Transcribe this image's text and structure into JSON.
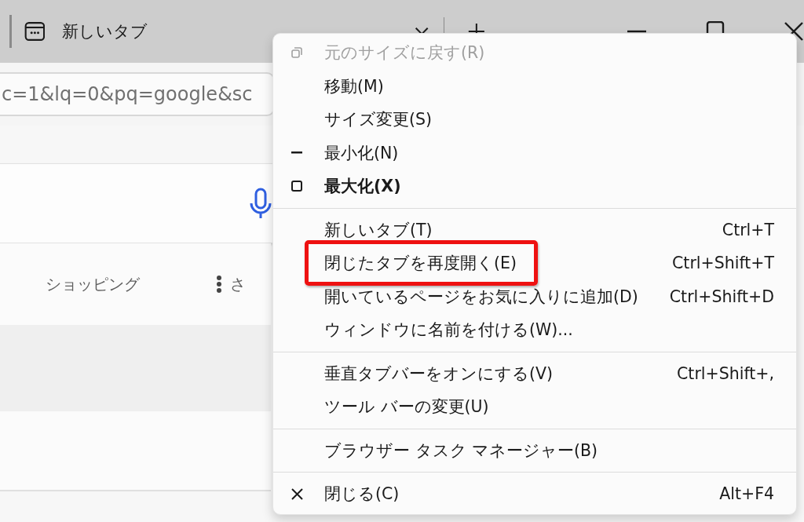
{
  "window": {
    "tab_title": "新しいタブ"
  },
  "address_bar": {
    "value": "c=1&lq=0&pq=google&sc"
  },
  "nav": {
    "items": [
      "ショッピング"
    ],
    "more_label": "さ"
  },
  "system_menu": [
    {
      "kind": "restore",
      "label": "元のサイズに戻す(R)",
      "disabled": true,
      "default": false,
      "highlighted": false
    },
    {
      "kind": "plain",
      "label": "移動(M)",
      "disabled": false,
      "default": false,
      "highlighted": false
    },
    {
      "kind": "plain",
      "label": "サイズ変更(S)",
      "disabled": false,
      "default": false,
      "highlighted": false
    },
    {
      "kind": "minimize",
      "label": "最小化(N)",
      "disabled": false,
      "default": false,
      "highlighted": false
    },
    {
      "kind": "maximize",
      "label": "最大化(X)",
      "disabled": false,
      "default": true,
      "highlighted": false
    },
    {
      "kind": "separator"
    },
    {
      "kind": "plain",
      "label": "新しいタブ(T)",
      "shortcut": "Ctrl+T",
      "disabled": false,
      "default": false,
      "highlighted": false
    },
    {
      "kind": "plain",
      "label": "閉じたタブを再度開く(E)",
      "shortcut": "Ctrl+Shift+T",
      "disabled": false,
      "default": false,
      "highlighted": true
    },
    {
      "kind": "plain",
      "label": "開いているページをお気に入りに追加(D)",
      "shortcut": "Ctrl+Shift+D",
      "disabled": false,
      "default": false,
      "highlighted": false
    },
    {
      "kind": "plain",
      "label": "ウィンドウに名前を付ける(W)...",
      "disabled": false,
      "default": false,
      "highlighted": false
    },
    {
      "kind": "separator"
    },
    {
      "kind": "plain",
      "label": "垂直タブバーをオンにする(V)",
      "shortcut": "Ctrl+Shift+,",
      "disabled": false,
      "default": false,
      "highlighted": false
    },
    {
      "kind": "plain",
      "label": "ツール バーの変更(U)",
      "disabled": false,
      "default": false,
      "highlighted": false
    },
    {
      "kind": "separator"
    },
    {
      "kind": "plain",
      "label": "ブラウザー タスク マネージャー(B)",
      "disabled": false,
      "default": false,
      "highlighted": false
    },
    {
      "kind": "separator"
    },
    {
      "kind": "close",
      "label": "閉じる(C)",
      "shortcut": "Alt+F4",
      "disabled": false,
      "default": false,
      "highlighted": false
    }
  ]
}
